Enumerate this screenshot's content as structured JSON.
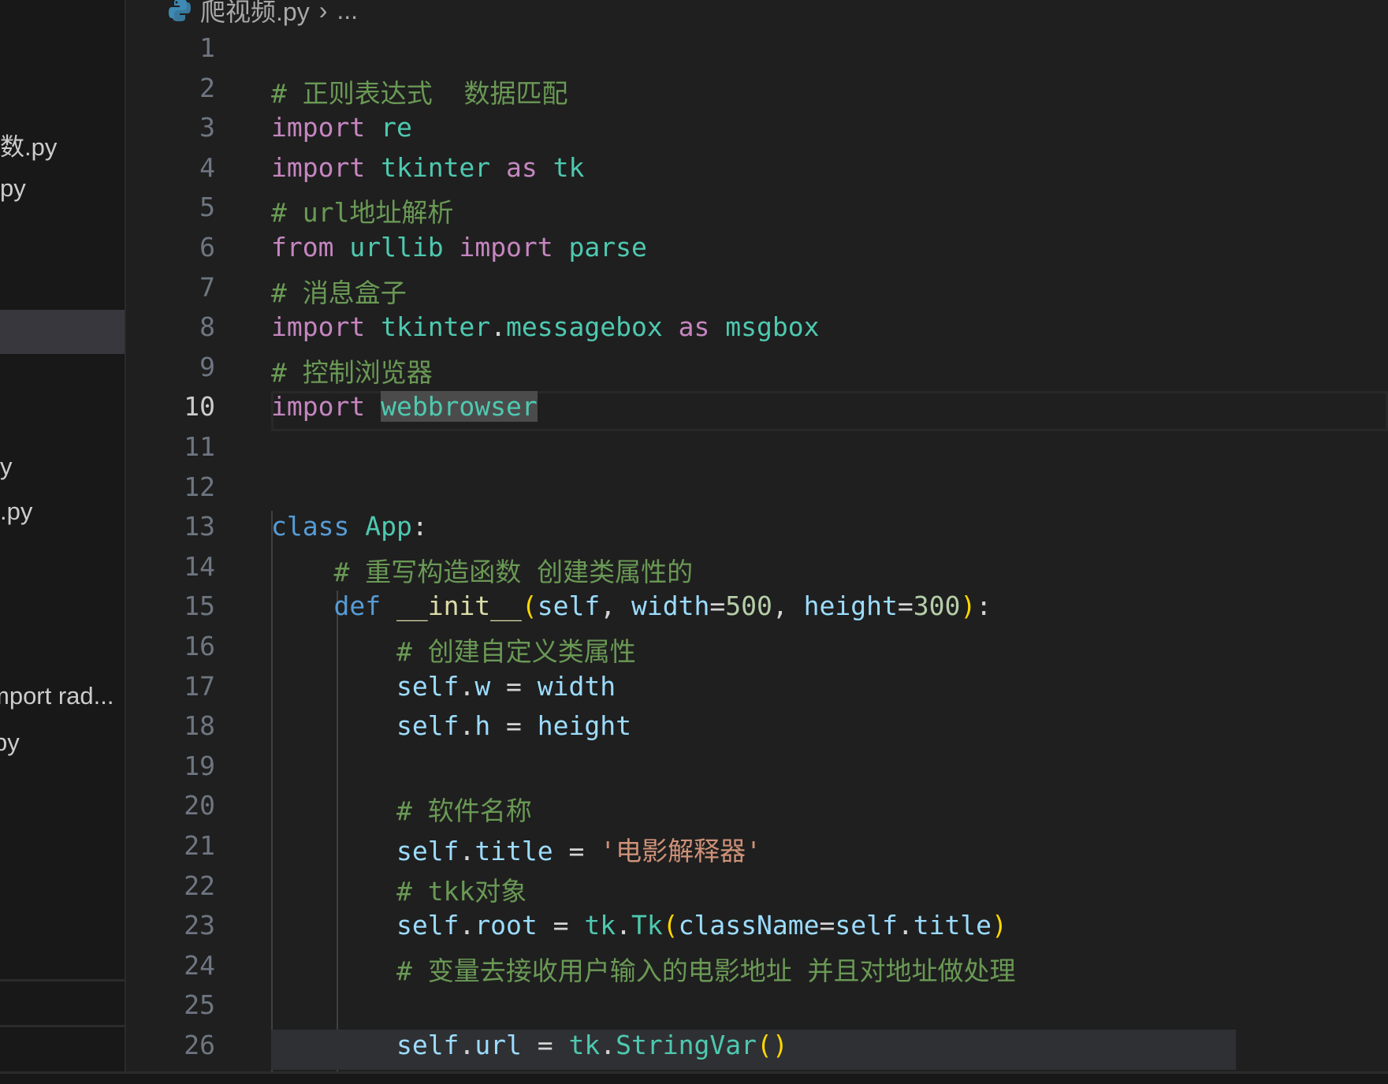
{
  "sidebar": {
    "items": [
      {
        "label": "数.py"
      },
      {
        "label": "py"
      },
      {
        "label": ""
      },
      {
        "label": "y"
      },
      {
        "label": ".py"
      },
      {
        "label": "mport rad..."
      },
      {
        "label": "py"
      }
    ]
  },
  "breadcrumb": {
    "file": "爬视频.py",
    "separator": "›",
    "more": "..."
  },
  "editor": {
    "active_line": 10,
    "lines": [
      [],
      [
        {
          "t": "# 正则表达式  数据匹配",
          "c": "cm"
        }
      ],
      [
        {
          "t": "import",
          "c": "kw"
        },
        {
          "t": " ",
          "c": "pl"
        },
        {
          "t": "re",
          "c": "md"
        }
      ],
      [
        {
          "t": "import",
          "c": "kw"
        },
        {
          "t": " ",
          "c": "pl"
        },
        {
          "t": "tkinter",
          "c": "md"
        },
        {
          "t": " ",
          "c": "pl"
        },
        {
          "t": "as",
          "c": "kw"
        },
        {
          "t": " ",
          "c": "pl"
        },
        {
          "t": "tk",
          "c": "md"
        }
      ],
      [
        {
          "t": "# url地址解析",
          "c": "cm"
        }
      ],
      [
        {
          "t": "from",
          "c": "kw"
        },
        {
          "t": " ",
          "c": "pl"
        },
        {
          "t": "urllib",
          "c": "md"
        },
        {
          "t": " ",
          "c": "pl"
        },
        {
          "t": "import",
          "c": "kw"
        },
        {
          "t": " ",
          "c": "pl"
        },
        {
          "t": "parse",
          "c": "md"
        }
      ],
      [
        {
          "t": "# 消息盒子",
          "c": "cm"
        }
      ],
      [
        {
          "t": "import",
          "c": "kw"
        },
        {
          "t": " ",
          "c": "pl"
        },
        {
          "t": "tkinter",
          "c": "md"
        },
        {
          "t": ".",
          "c": "pl"
        },
        {
          "t": "messagebox",
          "c": "md"
        },
        {
          "t": " ",
          "c": "pl"
        },
        {
          "t": "as",
          "c": "kw"
        },
        {
          "t": " ",
          "c": "pl"
        },
        {
          "t": "msgbox",
          "c": "md"
        }
      ],
      [
        {
          "t": "# 控制浏览器",
          "c": "cm"
        }
      ],
      [
        {
          "t": "import",
          "c": "kw"
        },
        {
          "t": " ",
          "c": "pl"
        },
        {
          "t": "webbrowser",
          "c": "md hl"
        }
      ],
      [],
      [],
      [
        {
          "t": "class",
          "c": "st"
        },
        {
          "t": " ",
          "c": "pl"
        },
        {
          "t": "App",
          "c": "md"
        },
        {
          "t": ":",
          "c": "pl"
        }
      ],
      [
        {
          "t": "    ",
          "c": "pl"
        },
        {
          "t": "# 重写构造函数 创建类属性的",
          "c": "cm"
        }
      ],
      [
        {
          "t": "    ",
          "c": "pl"
        },
        {
          "t": "def",
          "c": "st"
        },
        {
          "t": " ",
          "c": "pl"
        },
        {
          "t": "__init__",
          "c": "fn"
        },
        {
          "t": "(",
          "c": "br"
        },
        {
          "t": "self",
          "c": "vr"
        },
        {
          "t": ", ",
          "c": "pl"
        },
        {
          "t": "width",
          "c": "vr"
        },
        {
          "t": "=",
          "c": "pl"
        },
        {
          "t": "500",
          "c": "nm"
        },
        {
          "t": ", ",
          "c": "pl"
        },
        {
          "t": "height",
          "c": "vr"
        },
        {
          "t": "=",
          "c": "pl"
        },
        {
          "t": "300",
          "c": "nm"
        },
        {
          "t": ")",
          "c": "br"
        },
        {
          "t": ":",
          "c": "pl"
        }
      ],
      [
        {
          "t": "        ",
          "c": "pl"
        },
        {
          "t": "# 创建自定义类属性",
          "c": "cm"
        }
      ],
      [
        {
          "t": "        ",
          "c": "pl"
        },
        {
          "t": "self",
          "c": "vr"
        },
        {
          "t": ".",
          "c": "pl"
        },
        {
          "t": "w",
          "c": "vr"
        },
        {
          "t": " = ",
          "c": "pl"
        },
        {
          "t": "width",
          "c": "vr"
        }
      ],
      [
        {
          "t": "        ",
          "c": "pl"
        },
        {
          "t": "self",
          "c": "vr"
        },
        {
          "t": ".",
          "c": "pl"
        },
        {
          "t": "h",
          "c": "vr"
        },
        {
          "t": " = ",
          "c": "pl"
        },
        {
          "t": "height",
          "c": "vr"
        }
      ],
      [],
      [
        {
          "t": "        ",
          "c": "pl"
        },
        {
          "t": "# 软件名称",
          "c": "cm"
        }
      ],
      [
        {
          "t": "        ",
          "c": "pl"
        },
        {
          "t": "self",
          "c": "vr"
        },
        {
          "t": ".",
          "c": "pl"
        },
        {
          "t": "title",
          "c": "vr"
        },
        {
          "t": " = ",
          "c": "pl"
        },
        {
          "t": "'电影解释器'",
          "c": "sr"
        }
      ],
      [
        {
          "t": "        ",
          "c": "pl"
        },
        {
          "t": "# tkk对象",
          "c": "cm"
        }
      ],
      [
        {
          "t": "        ",
          "c": "pl"
        },
        {
          "t": "self",
          "c": "vr"
        },
        {
          "t": ".",
          "c": "pl"
        },
        {
          "t": "root",
          "c": "vr"
        },
        {
          "t": " = ",
          "c": "pl"
        },
        {
          "t": "tk",
          "c": "md"
        },
        {
          "t": ".",
          "c": "pl"
        },
        {
          "t": "Tk",
          "c": "md"
        },
        {
          "t": "(",
          "c": "br"
        },
        {
          "t": "className",
          "c": "vr"
        },
        {
          "t": "=",
          "c": "pl"
        },
        {
          "t": "self",
          "c": "vr"
        },
        {
          "t": ".",
          "c": "pl"
        },
        {
          "t": "title",
          "c": "vr"
        },
        {
          "t": ")",
          "c": "br"
        }
      ],
      [
        {
          "t": "        ",
          "c": "pl"
        },
        {
          "t": "# 变量去接收用户输入的电影地址 并且对地址做处理",
          "c": "cm"
        }
      ],
      [],
      [
        {
          "t": "        ",
          "c": "pl"
        },
        {
          "t": "self",
          "c": "vr"
        },
        {
          "t": ".",
          "c": "pl"
        },
        {
          "t": "url",
          "c": "vr"
        },
        {
          "t": " = ",
          "c": "pl"
        },
        {
          "t": "tk",
          "c": "md"
        },
        {
          "t": ".",
          "c": "pl"
        },
        {
          "t": "StringVar",
          "c": "md"
        },
        {
          "t": "(",
          "c": "br"
        },
        {
          "t": ")",
          "c": "br"
        }
      ]
    ]
  },
  "colors": {
    "background": "#1f1f1f",
    "sidebar": "#181818",
    "comment": "#6a9955",
    "keyword": "#c586c0",
    "module": "#4ec9b0",
    "storage": "#569cd6",
    "variable": "#9cdcfe",
    "function": "#dcdcaa",
    "number": "#b5cea8",
    "string": "#ce9178",
    "bracket": "#ffd700"
  }
}
